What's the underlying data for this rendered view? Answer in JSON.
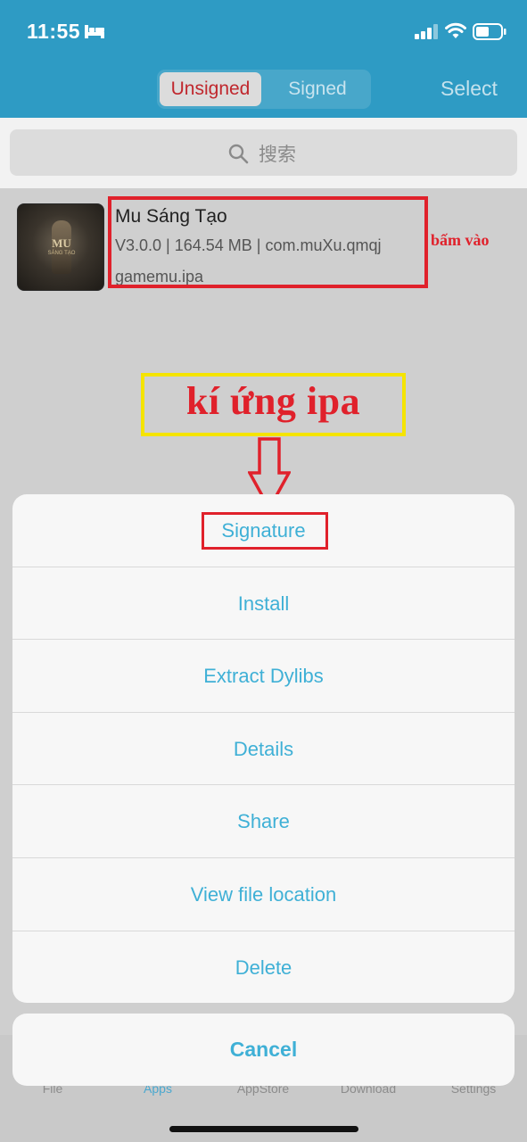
{
  "status_bar": {
    "time": "11:55"
  },
  "header": {
    "segments": [
      {
        "label": "Unsigned",
        "selected": true
      },
      {
        "label": "Signed",
        "selected": false
      }
    ],
    "select_label": "Select"
  },
  "search": {
    "placeholder": "搜索"
  },
  "app": {
    "name": "Mu Sáng Tạo",
    "meta": "V3.0.0 | 164.54 MB | com.muXu.qmqj",
    "file": "gamemu.ipa",
    "thumb_logo": "MU",
    "thumb_sub": "SÁNG TẠO"
  },
  "annotations": {
    "tap_note": "bấm vào",
    "title": "kí ứng ipa"
  },
  "action_sheet": {
    "items": [
      "Signature",
      "Install",
      "Extract Dylibs",
      "Details",
      "Share",
      "View file location",
      "Delete"
    ],
    "cancel": "Cancel"
  },
  "tabbar": {
    "tabs": [
      {
        "label": "File",
        "active": false
      },
      {
        "label": "Apps",
        "active": true
      },
      {
        "label": "AppStore",
        "active": false
      },
      {
        "label": "Download",
        "active": false
      },
      {
        "label": "Settings",
        "active": false
      }
    ]
  },
  "colors": {
    "header_bg": "#2e9bc4",
    "accent": "#3fb0d6",
    "annotation_red": "#e0212b",
    "annotation_yellow": "#f5e400"
  }
}
